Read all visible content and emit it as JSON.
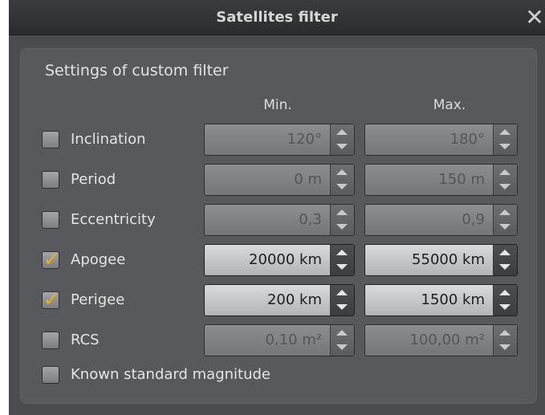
{
  "window": {
    "title": "Satellites filter",
    "close_icon": "close-icon"
  },
  "panel": {
    "title": "Settings of custom filter",
    "min_header": "Min.",
    "max_header": "Max."
  },
  "colors": {
    "checkmark": "#f0b400",
    "window_bg": "#4b4c4f",
    "panel_bg": "#58595c"
  },
  "rows": [
    {
      "label": "Inclination",
      "checked": false,
      "min": "120°",
      "max": "180°"
    },
    {
      "label": "Period",
      "checked": false,
      "min": "0 m",
      "max": "150 m"
    },
    {
      "label": "Eccentricity",
      "checked": false,
      "min": "0,3",
      "max": "0,9"
    },
    {
      "label": "Apogee",
      "checked": true,
      "min": "20000 km",
      "max": "55000 km"
    },
    {
      "label": "Perigee",
      "checked": true,
      "min": "200 km",
      "max": "1500 km"
    },
    {
      "label": "RCS",
      "checked": false,
      "min": "0,10 m²",
      "max": "100,00 m²"
    }
  ],
  "known_magnitude": {
    "label": "Known standard magnitude",
    "checked": false
  }
}
